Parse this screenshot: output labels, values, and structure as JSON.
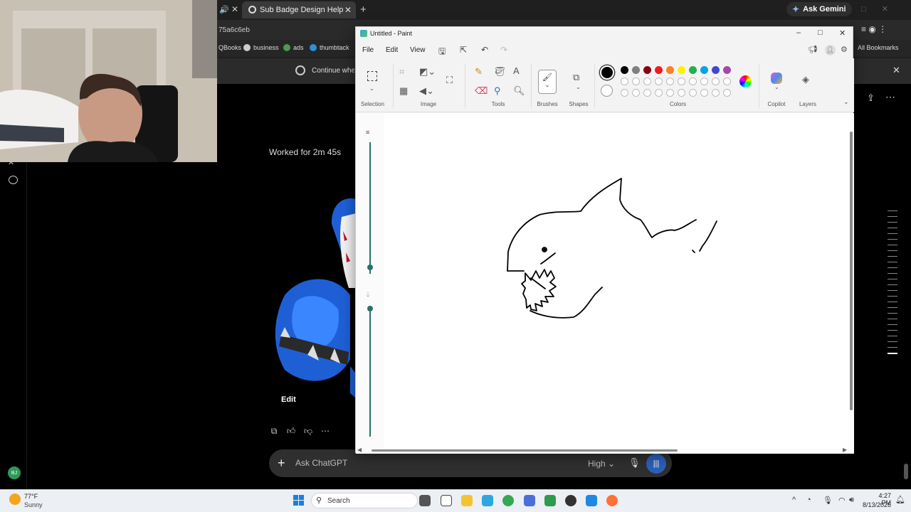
{
  "browser": {
    "tab_title": "Sub Badge Design Help",
    "ask_gemini": "Ask Gemini",
    "url_fragment": "75a6c6eb",
    "bookmarks": [
      "QBooks",
      "business",
      "ads",
      "thumbtack"
    ],
    "all_bookmarks": "All Bookmarks",
    "continue_banner": "Continue where"
  },
  "chat": {
    "worked_for": "Worked for 2m 45s",
    "edit_label": "Edit",
    "composer_placeholder": "Ask ChatGPT",
    "model": "High",
    "avatar_initials": "BJ"
  },
  "paint": {
    "title": "Untitled - Paint",
    "menu": [
      "File",
      "Edit",
      "View"
    ],
    "groups": {
      "selection": "Selection",
      "image": "Image",
      "tools": "Tools",
      "brushes": "Brushes",
      "shapes": "Shapes",
      "colors": "Colors",
      "copilot": "Copilot",
      "layers": "Layers"
    },
    "palette_row1": [
      "#000000",
      "#7f7f7f",
      "#880015",
      "#ed1c24",
      "#ff7f27",
      "#fff200",
      "#22b14c",
      "#00a2e8",
      "#3f48cc",
      "#a349a4"
    ],
    "palette_row2": [
      "#ffffff",
      "#c3c3c3",
      "#b97a57",
      "#ffaec9",
      "#ffc90e",
      "#efe4b0",
      "#b5e61d",
      "#99d9ea",
      "#7092be",
      "#c8bfe7"
    ],
    "active_color": "#000000"
  },
  "taskbar": {
    "temperature": "77°F",
    "weather": "Sunny",
    "search_label": "Search",
    "time": "4:27 PM",
    "date": "8/13/2026"
  }
}
